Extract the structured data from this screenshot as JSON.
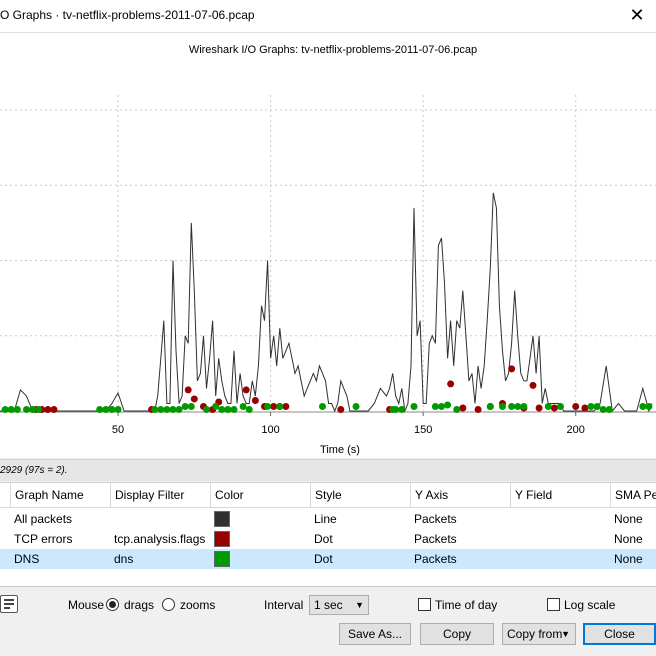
{
  "window": {
    "title": "O Graphs · tv-netflix-problems-2011-07-06.pcap",
    "close_glyph": "✕"
  },
  "chart_data": {
    "type": "line",
    "title": "Wireshark I/O Graphs: tv-netflix-problems-2011-07-06.pcap",
    "xlabel": "Time (s)",
    "ylabel": "",
    "x_ticks": [
      50,
      100,
      150,
      200
    ],
    "xlim": [
      10,
      225
    ],
    "ylim": [
      0,
      210
    ],
    "grid": true,
    "series": [
      {
        "name": "All packets",
        "style": "Line",
        "color": "#303030",
        "x": [
          10,
          12,
          14,
          16,
          18,
          20,
          22,
          24,
          26,
          28,
          30,
          32,
          34,
          36,
          38,
          40,
          42,
          44,
          46,
          48,
          50,
          52,
          54,
          56,
          58,
          60,
          61,
          62,
          63,
          64,
          65,
          66,
          67,
          68,
          69,
          70,
          71,
          72,
          73,
          74,
          75,
          76,
          77,
          78,
          79,
          80,
          81,
          82,
          83,
          84,
          85,
          86,
          87,
          88,
          89,
          90,
          91,
          92,
          93,
          94,
          95,
          96,
          97,
          98,
          99,
          100,
          101,
          102,
          103,
          104,
          105,
          106,
          107,
          108,
          109,
          110,
          111,
          112,
          113,
          114,
          115,
          116,
          117,
          118,
          119,
          120,
          121,
          122,
          123,
          124,
          125,
          126,
          128,
          130,
          132,
          134,
          136,
          138,
          139,
          140,
          141,
          142,
          143,
          144,
          145,
          146,
          147,
          148,
          149,
          150,
          151,
          152,
          153,
          154,
          155,
          156,
          157,
          158,
          159,
          160,
          161,
          162,
          163,
          164,
          165,
          166,
          167,
          168,
          169,
          170,
          171,
          172,
          173,
          174,
          175,
          176,
          177,
          178,
          179,
          180,
          181,
          182,
          183,
          184,
          185,
          186,
          187,
          188,
          189,
          190,
          191,
          192,
          193,
          194,
          195,
          196,
          198,
          200,
          202,
          204,
          206,
          208,
          210,
          212,
          214,
          216,
          218,
          220,
          222,
          224,
          225
        ],
        "y": [
          0,
          0,
          0,
          0,
          14,
          10,
          0,
          0,
          0,
          0,
          0,
          0,
          0,
          0,
          0,
          0,
          0,
          0,
          0,
          5,
          12,
          0,
          0,
          0,
          0,
          0,
          0,
          0,
          10,
          35,
          60,
          5,
          5,
          100,
          40,
          5,
          10,
          50,
          45,
          125,
          80,
          20,
          25,
          50,
          15,
          35,
          60,
          10,
          35,
          20,
          10,
          5,
          5,
          40,
          5,
          25,
          10,
          5,
          5,
          20,
          10,
          30,
          70,
          60,
          100,
          35,
          50,
          30,
          55,
          35,
          40,
          45,
          35,
          25,
          30,
          20,
          10,
          15,
          20,
          25,
          20,
          30,
          25,
          20,
          5,
          5,
          0,
          5,
          20,
          15,
          10,
          0,
          0,
          0,
          0,
          5,
          15,
          10,
          15,
          25,
          10,
          5,
          15,
          0,
          5,
          30,
          135,
          50,
          60,
          5,
          5,
          45,
          50,
          45,
          110,
          115,
          85,
          35,
          60,
          30,
          60,
          55,
          80,
          50,
          20,
          25,
          5,
          30,
          15,
          30,
          60,
          95,
          145,
          135,
          70,
          40,
          20,
          25,
          45,
          80,
          50,
          25,
          20,
          20,
          35,
          50,
          25,
          50,
          5,
          15,
          5,
          5,
          5,
          5,
          5,
          0,
          0,
          0,
          0,
          0,
          0,
          5,
          30,
          0,
          5,
          0,
          0,
          0,
          15,
          0,
          5
        ]
      },
      {
        "name": "TCP errors",
        "style": "Dot",
        "color": "#990000",
        "x": [
          23,
          25,
          27,
          29,
          61,
          73,
          75,
          78,
          81,
          83,
          92,
          95,
          98,
          101,
          103,
          105,
          123,
          139,
          159,
          163,
          168,
          172,
          176,
          179,
          183,
          186,
          188,
          193,
          200,
          203
        ],
        "y": [
          1,
          1,
          1,
          1,
          1,
          14,
          8,
          3,
          1,
          6,
          14,
          7,
          3,
          3,
          3,
          3,
          1,
          1,
          18,
          2,
          1,
          3,
          5,
          28,
          2,
          17,
          2,
          2,
          3,
          2
        ]
      },
      {
        "name": "DNS",
        "style": "Dot",
        "color": "#009900",
        "x": [
          13,
          15,
          17,
          20,
          22,
          24,
          44,
          46,
          48,
          50,
          62,
          64,
          66,
          68,
          70,
          72,
          74,
          79,
          82,
          84,
          86,
          88,
          91,
          93,
          99,
          103,
          117,
          128,
          140,
          141,
          143,
          147,
          154,
          156,
          158,
          161,
          172,
          176,
          179,
          181,
          183,
          191,
          195,
          205,
          207,
          209,
          211,
          222,
          224
        ],
        "y": [
          1,
          1,
          1,
          1,
          1,
          1,
          1,
          1,
          1,
          1,
          1,
          1,
          1,
          1,
          1,
          3,
          3,
          1,
          3,
          1,
          1,
          1,
          3,
          1,
          3,
          3,
          3,
          3,
          1,
          1,
          1,
          3,
          3,
          3,
          4,
          1,
          3,
          3,
          3,
          3,
          3,
          3,
          3,
          3,
          3,
          1,
          1,
          3,
          3
        ]
      }
    ]
  },
  "hint": "2929 (97s = 2).",
  "table": {
    "headers": [
      "Graph Name",
      "Display Filter",
      "Color",
      "Style",
      "Y Axis",
      "Y Field",
      "SMA Pe"
    ],
    "rows": [
      {
        "name": "All packets",
        "filter": "",
        "color": "#303030",
        "style": "Line",
        "yaxis": "Packets",
        "yfield": "",
        "sma": "None",
        "selected": false
      },
      {
        "name": "TCP errors",
        "filter": "tcp.analysis.flags",
        "color": "#990000",
        "style": "Dot",
        "yaxis": "Packets",
        "yfield": "",
        "sma": "None",
        "selected": false
      },
      {
        "name": "DNS",
        "filter": "dns",
        "color": "#009900",
        "style": "Dot",
        "yaxis": "Packets",
        "yfield": "",
        "sma": "None",
        "selected": true
      }
    ]
  },
  "controls": {
    "mouse_label": "Mouse",
    "drags_label": "drags",
    "zooms_label": "zooms",
    "mouse_mode": "drags",
    "interval_label": "Interval",
    "interval_value": "1 sec",
    "time_of_day_label": "Time of day",
    "log_scale_label": "Log scale",
    "save_as": "Save As...",
    "copy": "Copy",
    "copy_from": "Copy from",
    "close": "Close"
  }
}
